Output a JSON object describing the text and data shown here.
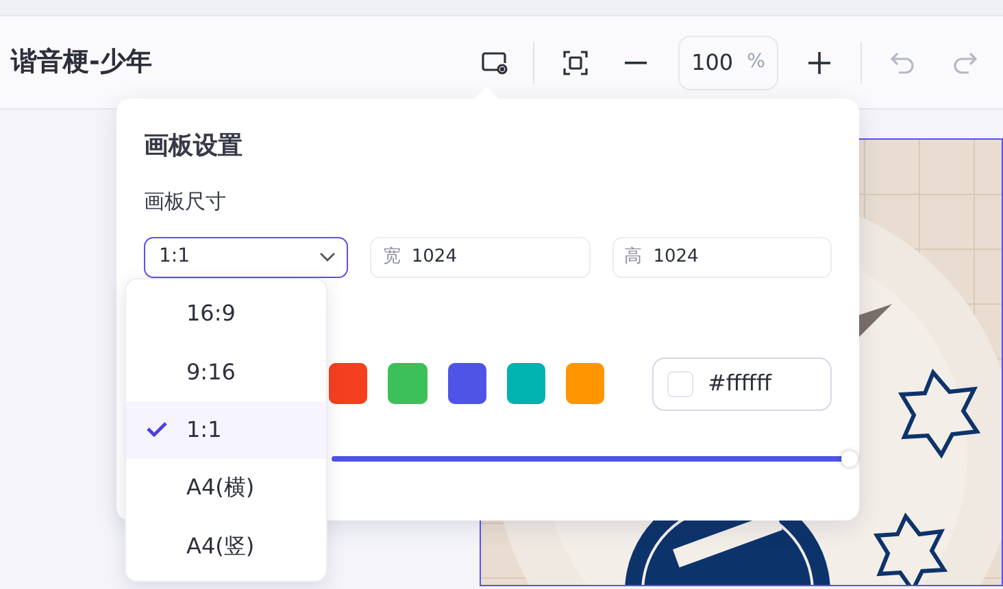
{
  "title": "谐音梗-少年",
  "toolbar": {
    "zoom": {
      "value": "100",
      "unit": "%"
    },
    "undo": {
      "disabled": true
    },
    "redo": {
      "disabled": true
    }
  },
  "panel": {
    "title": "画板设置",
    "size_label": "画板尺寸",
    "ratio_select": {
      "value": "1:1",
      "open": true
    },
    "width": {
      "label": "宽",
      "value": "1024"
    },
    "height": {
      "label": "高",
      "value": "1024"
    },
    "swatches": [
      {
        "color": "#f5401f"
      },
      {
        "color": "#3cc05a"
      },
      {
        "color": "#4f54e6"
      },
      {
        "color": "#00b2b0"
      },
      {
        "color": "#ff9500"
      }
    ],
    "hex": {
      "value": "#ffffff"
    },
    "slider": {
      "level": 1
    }
  },
  "dropdown": [
    {
      "label": "16:9",
      "selected": false
    },
    {
      "label": "9:16",
      "selected": false
    },
    {
      "label": "1:1",
      "selected": true
    },
    {
      "label": "A4(横)",
      "selected": false
    },
    {
      "label": "A4(竖)",
      "selected": false
    }
  ]
}
